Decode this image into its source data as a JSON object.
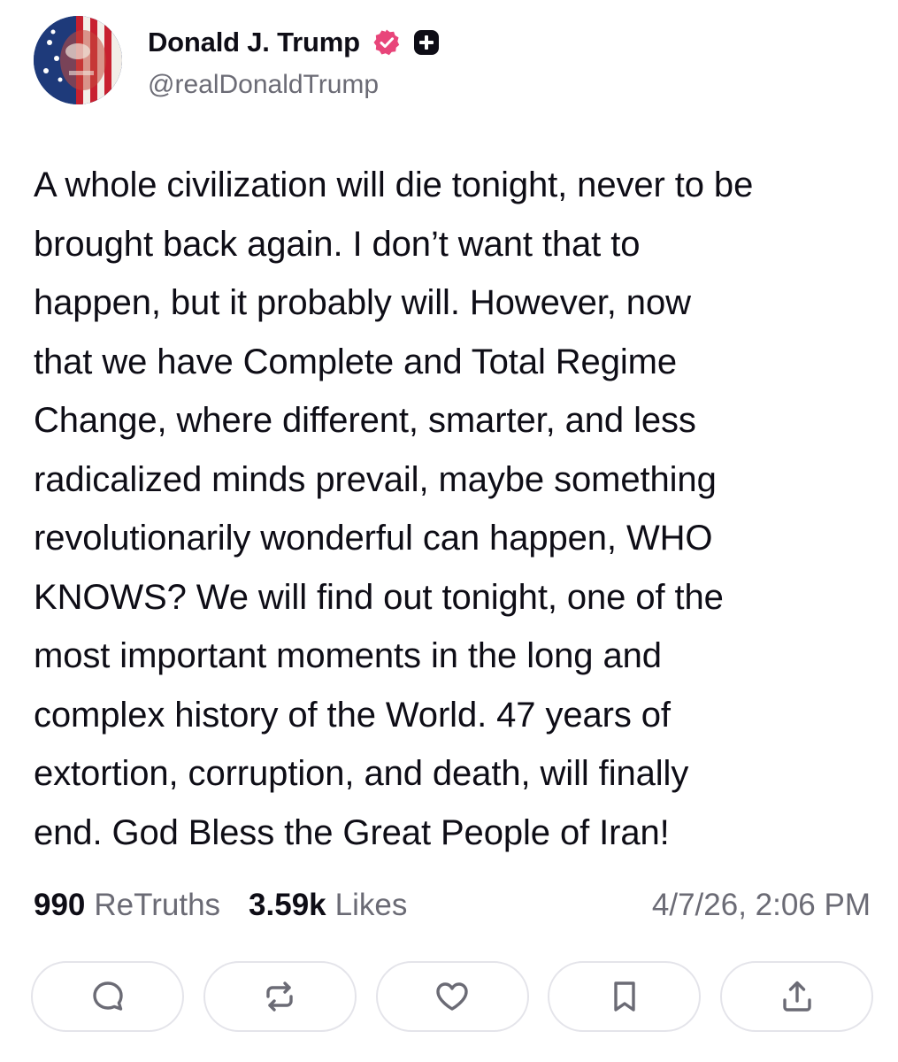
{
  "author": {
    "display_name": "Donald J. Trump",
    "handle": "@realDonaldTrump",
    "avatar": "avatar",
    "verified_icon": "verified-badge-icon",
    "plus_icon": "plus-badge-icon"
  },
  "post": {
    "lines": [
      "A whole civilization will die tonight, never to be",
      "brought back again. I don’t want that to",
      "happen, but it probably will. However, now",
      "that we have Complete and Total Regime",
      "Change, where different, smarter, and less",
      "radicalized minds prevail, maybe something",
      "revolutionarily wonderful can happen, WHO",
      "KNOWS? We will find out tonight, one of the",
      "most important moments in the long and",
      "complex history of the World. 47 years of",
      "extortion, corruption, and death, will finally",
      "end. God Bless the Great People of Iran!"
    ]
  },
  "stats": {
    "retruths_count": "990",
    "retruths_label": "ReTruths",
    "likes_count": "3.59k",
    "likes_label": "Likes",
    "timestamp": "4/7/26, 2:06 PM"
  },
  "actions": [
    {
      "icon": "reply-icon"
    },
    {
      "icon": "retruth-icon"
    },
    {
      "icon": "like-heart-icon"
    },
    {
      "icon": "bookmark-icon"
    },
    {
      "icon": "share-icon"
    }
  ],
  "colors": {
    "text_primary": "#0e0d16",
    "text_secondary": "#6b6b75",
    "verified_pink": "#e8457a",
    "button_border": "#e4e4ea"
  }
}
